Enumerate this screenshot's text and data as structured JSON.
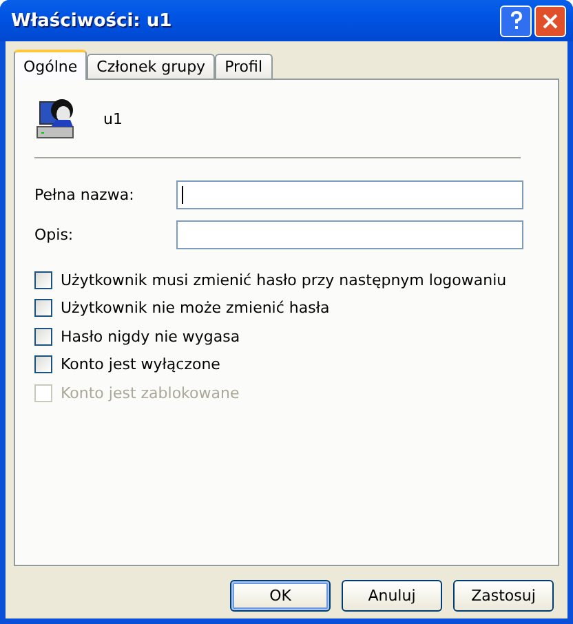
{
  "window": {
    "title": "Właściwości: u1"
  },
  "tabs": [
    {
      "label": "Ogólne",
      "selected": true
    },
    {
      "label": "Członek grupy",
      "selected": false
    },
    {
      "label": "Profil",
      "selected": false
    }
  ],
  "user": {
    "name": "u1"
  },
  "fields": [
    {
      "label": "Pełna nazwa:",
      "focused": true
    },
    {
      "label": "Opis:",
      "focused": false
    }
  ],
  "options": [
    {
      "label": "Użytkownik musi zmienić hasło przy następnym logowaniu",
      "checked": false,
      "disabled": false
    },
    {
      "label": "Użytkownik nie może zmienić hasła",
      "checked": false,
      "disabled": false
    },
    {
      "label": "Hasło nigdy nie wygasa",
      "checked": false,
      "disabled": false
    },
    {
      "label": "Konto jest wyłączone",
      "checked": false,
      "disabled": false
    },
    {
      "label": "Konto jest zablokowane",
      "checked": false,
      "disabled": true
    }
  ],
  "buttons": [
    {
      "label": "OK",
      "default": true
    },
    {
      "label": "Anuluj",
      "default": false
    },
    {
      "label": "Zastosuj",
      "default": false
    }
  ]
}
